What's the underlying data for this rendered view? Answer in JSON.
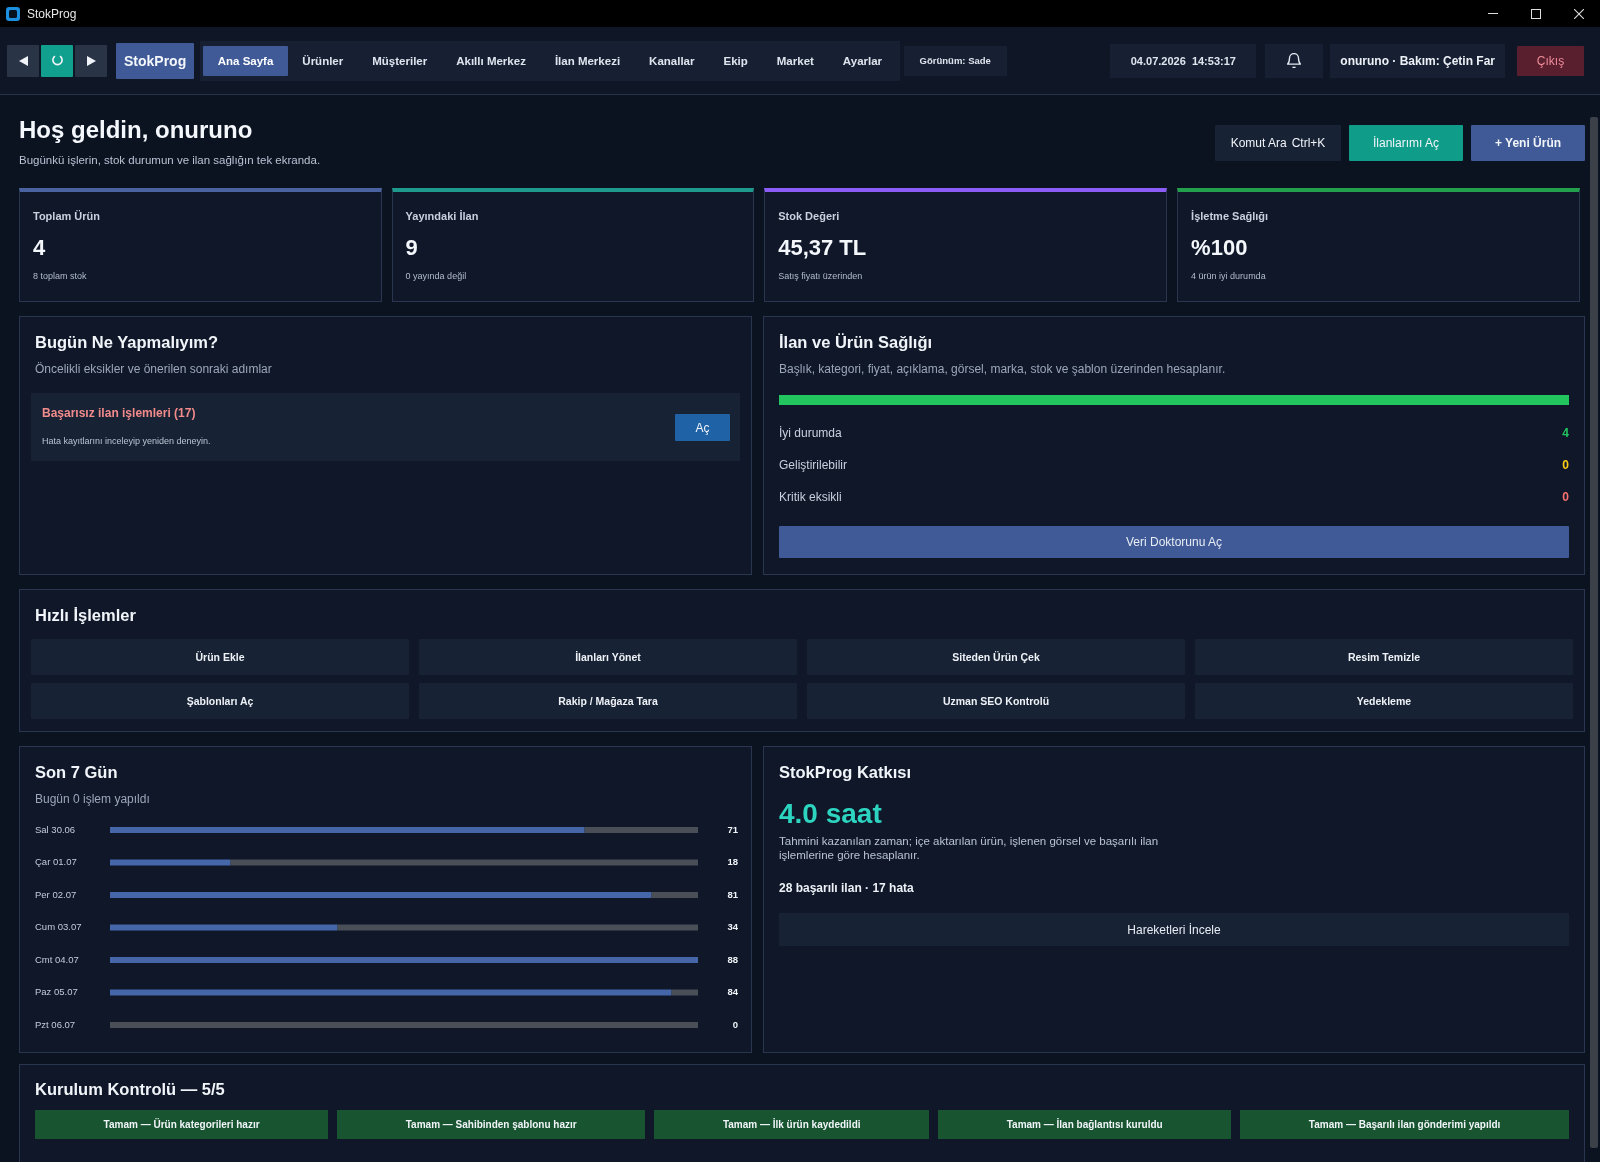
{
  "window": {
    "title": "StokProg"
  },
  "navbar": {
    "brand": "StokProg",
    "tabs": [
      {
        "label": "Ana Sayfa",
        "selected": true
      },
      {
        "label": "Ürünler",
        "selected": false
      },
      {
        "label": "Müşteriler",
        "selected": false
      },
      {
        "label": "Akıllı Merkez",
        "selected": false
      },
      {
        "label": "İlan Merkezi",
        "selected": false
      },
      {
        "label": "Kanallar",
        "selected": false
      },
      {
        "label": "Ekip",
        "selected": false
      },
      {
        "label": "Market",
        "selected": false
      },
      {
        "label": "Ayarlar",
        "selected": false
      }
    ],
    "view_mode": "Görünüm: Sade",
    "datetime": "04.07.2026  14:53:17",
    "user": "onuruno · Bakım: Çetin Far",
    "logout": "Çıkış"
  },
  "header": {
    "title": "Hoş geldin, onuruno",
    "subtitle": "Bugünkü işlerin, stok durumun ve ilan sağlığın tek ekranda.",
    "actions": [
      {
        "label": "Komut Ara",
        "shortcut": "Ctrl+K",
        "kind": "plain"
      },
      {
        "label": "İlanlarımı Aç",
        "kind": "accent"
      },
      {
        "label": "+ Yeni Ürün",
        "kind": "primary"
      }
    ]
  },
  "stats": [
    {
      "label": "Toplam Ürün",
      "value": "4",
      "note": "8 toplam stok",
      "color": "#4a63a0"
    },
    {
      "label": "Yayındaki İlan",
      "value": "9",
      "note": "0 yayında değil",
      "color": "#1d9a8c"
    },
    {
      "label": "Stok Değeri",
      "value": "45,37 TL",
      "note": "Satış fiyatı üzerinden",
      "color": "#8b5cf6"
    },
    {
      "label": "İşletme Sağlığı",
      "value": "%100",
      "note": "4 ürün iyi durumda",
      "color": "#22a04b"
    }
  ],
  "todo": {
    "title": "Bugün Ne Yapmalıyım?",
    "subtitle": "Öncelikli eksikler ve önerilen sonraki adımlar",
    "items": [
      {
        "kind": "error",
        "title": "Başarısız ilan işlemleri (17)",
        "detail": "Hata kayıtlarını inceleyip yeniden deneyin.",
        "action": "Aç"
      }
    ]
  },
  "health": {
    "title": "İlan ve Ürün Sağlığı",
    "subtitle": "Başlık, kategori, fiyat, açıklama, görsel, marka, stok ve şablon üzerinden hesaplanır.",
    "level": 1,
    "rows": [
      {
        "label": "İyi durumda",
        "count": "4",
        "color": "#22c55e"
      },
      {
        "label": "Geliştirilebilir",
        "count": "0",
        "color": "#facc15"
      },
      {
        "label": "Kritik eksikli",
        "count": "0",
        "color": "#f87171"
      }
    ],
    "action": "Veri Doktorunu Aç"
  },
  "quick_actions": {
    "title": "Hızlı İşlemler",
    "buttons": [
      "Ürün Ekle",
      "İlanları Yönet",
      "Siteden Ürün Çek",
      "Resim Temizle",
      "Şablonları Aç",
      "Rakip / Mağaza Tara",
      "Uzman SEO Kontrolü",
      "Yedekleme"
    ]
  },
  "weekly": {
    "title": "Son 7 Gün",
    "subtitle": "Bugün 0 işlem yapıldı",
    "chart_data": {
      "type": "bar",
      "orientation": "horizontal",
      "categories": [
        "Sal 30.06",
        "Çar 01.07",
        "Per 02.07",
        "Cum 03.07",
        "Cmt 04.07",
        "Paz 05.07",
        "Pzt 06.07"
      ],
      "values": [
        71,
        18,
        81,
        34,
        88,
        84,
        0
      ],
      "data_labels": true
    }
  },
  "contribution": {
    "title": "StokProg Katkısı",
    "hours": "4.0 saat",
    "description": "Tahmini kazanılan zaman; içe aktarılan ürün, işlenen görsel ve başarılı ilan işlemlerine göre hesaplanır.",
    "summary": "28 başarılı ilan · 17 hata",
    "action": "Hareketleri İncele"
  },
  "setup": {
    "title": "Kurulum Kontrolü — 5/5",
    "steps": [
      {
        "label": "Tamam — Ürün kategorileri hazır",
        "done": true
      },
      {
        "label": "Tamam — Sahibinden şablonu hazır",
        "done": true
      },
      {
        "label": "Tamam — İlk ürün kaydedildi",
        "done": true
      },
      {
        "label": "Tamam — İlan bağlantısı kuruldu",
        "done": true
      },
      {
        "label": "Tamam — Başarılı ilan gönderimi yapıldı",
        "done": true
      }
    ]
  }
}
